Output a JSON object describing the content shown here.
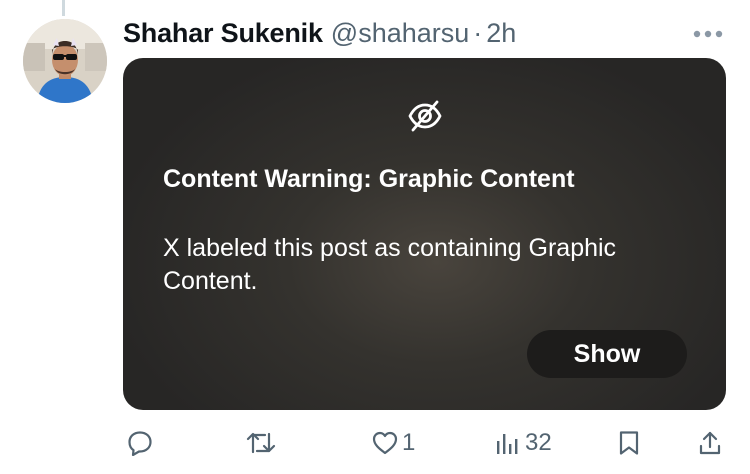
{
  "post": {
    "author": {
      "display_name": "Shahar Sukenik",
      "handle": "@shaharsu",
      "separator": "·",
      "time": "2h"
    },
    "content_warning": {
      "title": "Content Warning: Graphic Content",
      "body": "X labeled this post as containing Graphic Content.",
      "show_label": "Show"
    },
    "actions": {
      "reply_count": "",
      "repost_count": "",
      "like_count": "1",
      "view_count": "32"
    }
  },
  "icons": {
    "more": "more-horizontal-icon",
    "content_hidden": "eye-off-icon",
    "reply": "reply-icon",
    "repost": "repost-icon",
    "like": "heart-icon",
    "views": "views-chart-icon",
    "bookmark": "bookmark-icon",
    "share": "share-icon"
  },
  "colors": {
    "text_primary": "#0f1419",
    "text_secondary": "#536471",
    "card_background": "#2b2a28",
    "show_button": "#1d1c1b"
  }
}
